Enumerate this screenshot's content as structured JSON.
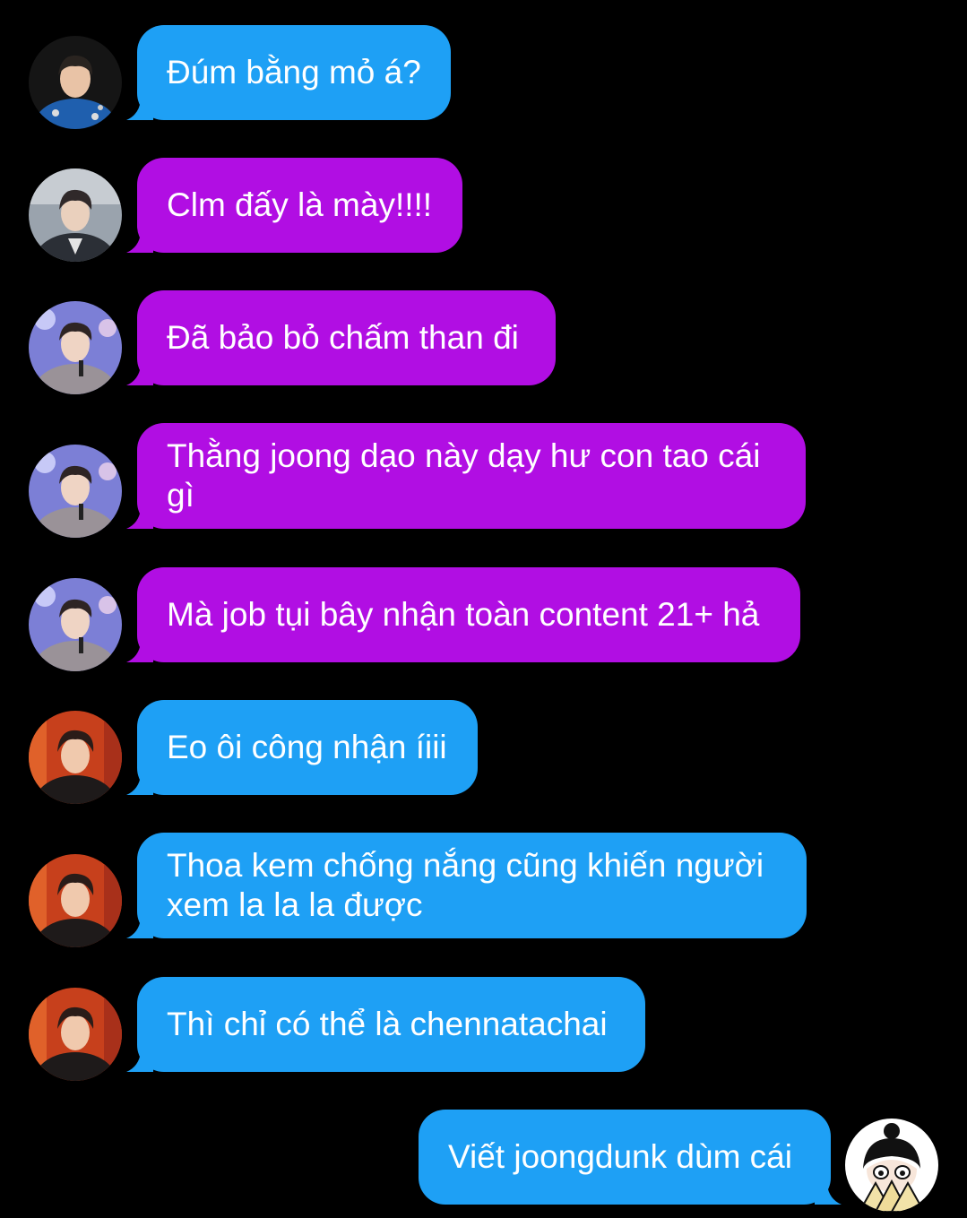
{
  "colors": {
    "background": "#000000",
    "blue_bubble": "#1ea0f5",
    "purple_bubble": "#b10ee3",
    "text": "#ffffff"
  },
  "messages": [
    {
      "sender": "avatar-a",
      "side": "left",
      "color": "blue",
      "text": "Đúm bằng mỏ á?"
    },
    {
      "sender": "avatar-b",
      "side": "left",
      "color": "purple",
      "text": "Clm đấy là mày!!!!"
    },
    {
      "sender": "avatar-c",
      "side": "left",
      "color": "purple",
      "text": "Đã bảo bỏ chấm than đi"
    },
    {
      "sender": "avatar-c",
      "side": "left",
      "color": "purple",
      "text": "Thằng joong dạo này dạy hư con tao cái gì"
    },
    {
      "sender": "avatar-c",
      "side": "left",
      "color": "purple",
      "text": "Mà job tụi bây nhận toàn content 21+ hả"
    },
    {
      "sender": "avatar-d",
      "side": "left",
      "color": "blue",
      "text": "Eo ôi công nhận íiii"
    },
    {
      "sender": "avatar-d",
      "side": "left",
      "color": "blue",
      "text": "Thoa kem chống nắng cũng khiến người xem la la la được"
    },
    {
      "sender": "avatar-d",
      "side": "left",
      "color": "blue",
      "text": "Thì chỉ có thể là chennatachai"
    },
    {
      "sender": "avatar-cartoon",
      "side": "right",
      "color": "blue",
      "text": "Viết joongdunk dùm cái"
    }
  ]
}
